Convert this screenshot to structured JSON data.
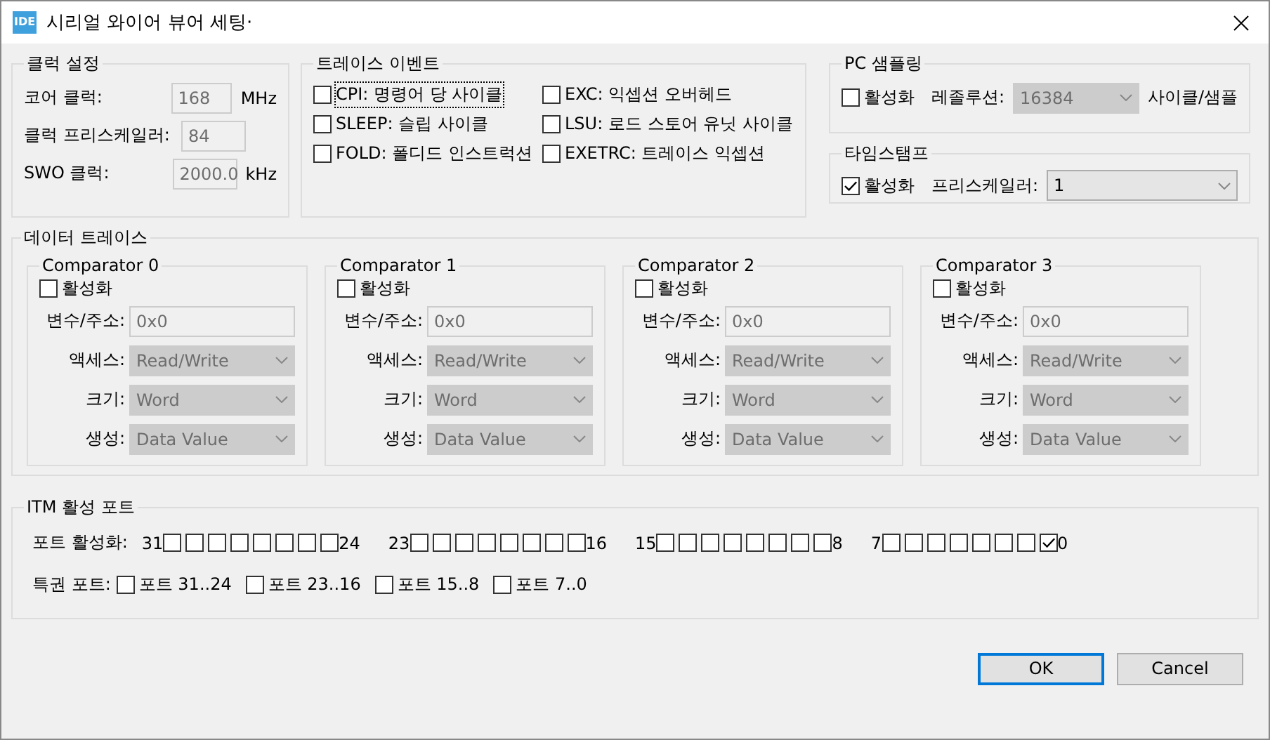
{
  "window": {
    "title": "시리얼 와이어 뷰어 세팅·",
    "logo": "IDE"
  },
  "clock": {
    "title": "클럭 설정",
    "rows": [
      {
        "label": "코어 클럭:",
        "value": "168",
        "unit": "MHz",
        "disabled": true
      },
      {
        "label": "클럭 프리스케일러:",
        "value": "84",
        "disabled": true
      },
      {
        "label": "SWO 클럭:",
        "value": "2000.0",
        "unit": "kHz",
        "disabled": true
      }
    ]
  },
  "trace_events": {
    "title": "트레이스 이벤트",
    "items": [
      {
        "label": "CPI: 명령어 당 사이클",
        "checked": false,
        "focused": true
      },
      {
        "label": "EXC: 익셉션 오버헤드",
        "checked": false,
        "focused": false
      },
      {
        "label": "SLEEP: 슬립 사이클",
        "checked": false,
        "focused": false
      },
      {
        "label": "LSU: 로드 스토어 유닛 사이클",
        "checked": false,
        "focused": false
      },
      {
        "label": "FOLD: 폴디드 인스트럭션",
        "checked": false,
        "focused": false
      },
      {
        "label": "EXETRC: 트레이스 익셉션",
        "checked": false,
        "focused": false
      }
    ]
  },
  "pc_sampling": {
    "title": "PC 샘플링",
    "enable": {
      "label": "활성화",
      "checked": false
    },
    "resolution_label": "레졸루션:",
    "resolution": {
      "value": "16384",
      "disabled": true
    },
    "unit": "사이클/샘플"
  },
  "timestamp": {
    "title": "타임스탬프",
    "enable": {
      "label": "활성화",
      "checked": true
    },
    "prescaler_label": "프리스케일러:",
    "prescaler": {
      "value": "1",
      "disabled": false
    }
  },
  "data_trace": {
    "title": "데이터 트레이스",
    "comparators": [
      {
        "title": "Comparator 0",
        "enable": {
          "label": "활성화",
          "checked": false
        },
        "fields": [
          {
            "kind": "input",
            "label": "변수/주소:",
            "value": "0x0",
            "disabled": true
          },
          {
            "kind": "select",
            "label": "액세스:",
            "value": "Read/Write",
            "disabled": true
          },
          {
            "kind": "select",
            "label": "크기:",
            "value": "Word",
            "disabled": true
          },
          {
            "kind": "select",
            "label": "생성:",
            "value": "Data Value",
            "disabled": true
          }
        ]
      },
      {
        "title": "Comparator 1",
        "enable": {
          "label": "활성화",
          "checked": false
        },
        "fields": [
          {
            "kind": "input",
            "label": "변수/주소:",
            "value": "0x0",
            "disabled": true
          },
          {
            "kind": "select",
            "label": "액세스:",
            "value": "Read/Write",
            "disabled": true
          },
          {
            "kind": "select",
            "label": "크기:",
            "value": "Word",
            "disabled": true
          },
          {
            "kind": "select",
            "label": "생성:",
            "value": "Data Value",
            "disabled": true
          }
        ]
      },
      {
        "title": "Comparator 2",
        "enable": {
          "label": "활성화",
          "checked": false
        },
        "fields": [
          {
            "kind": "input",
            "label": "변수/주소:",
            "value": "0x0",
            "disabled": true
          },
          {
            "kind": "select",
            "label": "액세스:",
            "value": "Read/Write",
            "disabled": true
          },
          {
            "kind": "select",
            "label": "크기:",
            "value": "Word",
            "disabled": true
          },
          {
            "kind": "select",
            "label": "생성:",
            "value": "Data Value",
            "disabled": true
          }
        ]
      },
      {
        "title": "Comparator 3",
        "enable": {
          "label": "활성화",
          "checked": false
        },
        "fields": [
          {
            "kind": "input",
            "label": "변수/주소:",
            "value": "0x0",
            "disabled": true
          },
          {
            "kind": "select",
            "label": "액세스:",
            "value": "Read/Write",
            "disabled": true
          },
          {
            "kind": "select",
            "label": "크기:",
            "value": "Word",
            "disabled": true
          },
          {
            "kind": "select",
            "label": "생성:",
            "value": "Data Value",
            "disabled": true
          }
        ]
      }
    ]
  },
  "itm": {
    "title": "ITM 활성 포트",
    "port_enable": {
      "label": "포트 활성화:",
      "groups": [
        {
          "high": "31",
          "low": "24",
          "bits": [
            {
              "checked": false
            },
            {
              "checked": false
            },
            {
              "checked": false
            },
            {
              "checked": false
            },
            {
              "checked": false
            },
            {
              "checked": false
            },
            {
              "checked": false
            },
            {
              "checked": false
            }
          ]
        },
        {
          "high": "23",
          "low": "16",
          "bits": [
            {
              "checked": false
            },
            {
              "checked": false
            },
            {
              "checked": false
            },
            {
              "checked": false
            },
            {
              "checked": false
            },
            {
              "checked": false
            },
            {
              "checked": false
            },
            {
              "checked": false
            }
          ]
        },
        {
          "high": "15",
          "low": "8",
          "bits": [
            {
              "checked": false
            },
            {
              "checked": false
            },
            {
              "checked": false
            },
            {
              "checked": false
            },
            {
              "checked": false
            },
            {
              "checked": false
            },
            {
              "checked": false
            },
            {
              "checked": false
            }
          ]
        },
        {
          "high": "7",
          "low": "0",
          "bits": [
            {
              "checked": false
            },
            {
              "checked": false
            },
            {
              "checked": false
            },
            {
              "checked": false
            },
            {
              "checked": false
            },
            {
              "checked": false
            },
            {
              "checked": false
            },
            {
              "checked": true
            }
          ]
        }
      ]
    },
    "privileged": {
      "label": "특권 포트:",
      "items": [
        {
          "label": "포트 31..24",
          "checked": false
        },
        {
          "label": "포트 23..16",
          "checked": false
        },
        {
          "label": "포트 15..8",
          "checked": false
        },
        {
          "label": "포트 7..0",
          "checked": false
        }
      ]
    }
  },
  "buttons": [
    {
      "label": "OK",
      "default": true
    },
    {
      "label": "Cancel",
      "default": false
    }
  ]
}
